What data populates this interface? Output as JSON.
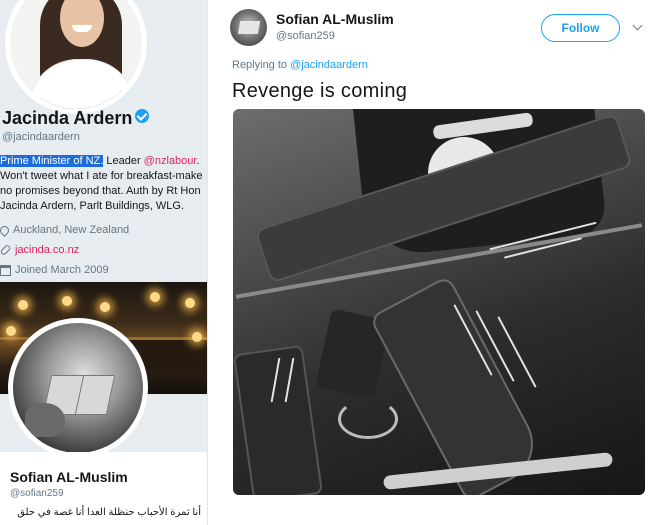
{
  "profile": {
    "name": "Jacinda Ardern",
    "handle": "@jacindaardern",
    "bio_highlight": "Prime Minister of NZ.",
    "bio_leader": " Leader ",
    "bio_mention": "@nzlabour",
    "bio_rest_1": ".",
    "bio_line2": "Won't tweet what I ate for breakfast-make",
    "bio_line3": "no promises beyond that. Auth by Rt Hon",
    "bio_line4": "Jacinda Ardern, Parlt Buildings, WLG.",
    "location": "Auckland, New Zealand",
    "website": "jacinda.co.nz",
    "joined": "Joined March 2009"
  },
  "second_profile": {
    "name": "Sofian AL-Muslim",
    "handle": "@sofian259",
    "bio": "أنا ثمرة الأحباب حنظلة العدا أنا غصة في حلق"
  },
  "tweet": {
    "author_name": "Sofian AL-Muslim",
    "author_handle": "@sofian259",
    "follow_label": "Follow",
    "replying_prefix": "Replying to ",
    "replying_mention": "@jacindaardern",
    "text": "Revenge is coming"
  },
  "colors": {
    "twitter_blue": "#1da1f2",
    "mention_pink": "#e0245e",
    "highlight": "#1e6cd8",
    "secondary_text": "#657786"
  },
  "icons": {
    "verified": "verified-icon",
    "location": "location-icon",
    "link": "link-icon",
    "calendar": "calendar-icon",
    "more": "chevron-down-icon"
  }
}
